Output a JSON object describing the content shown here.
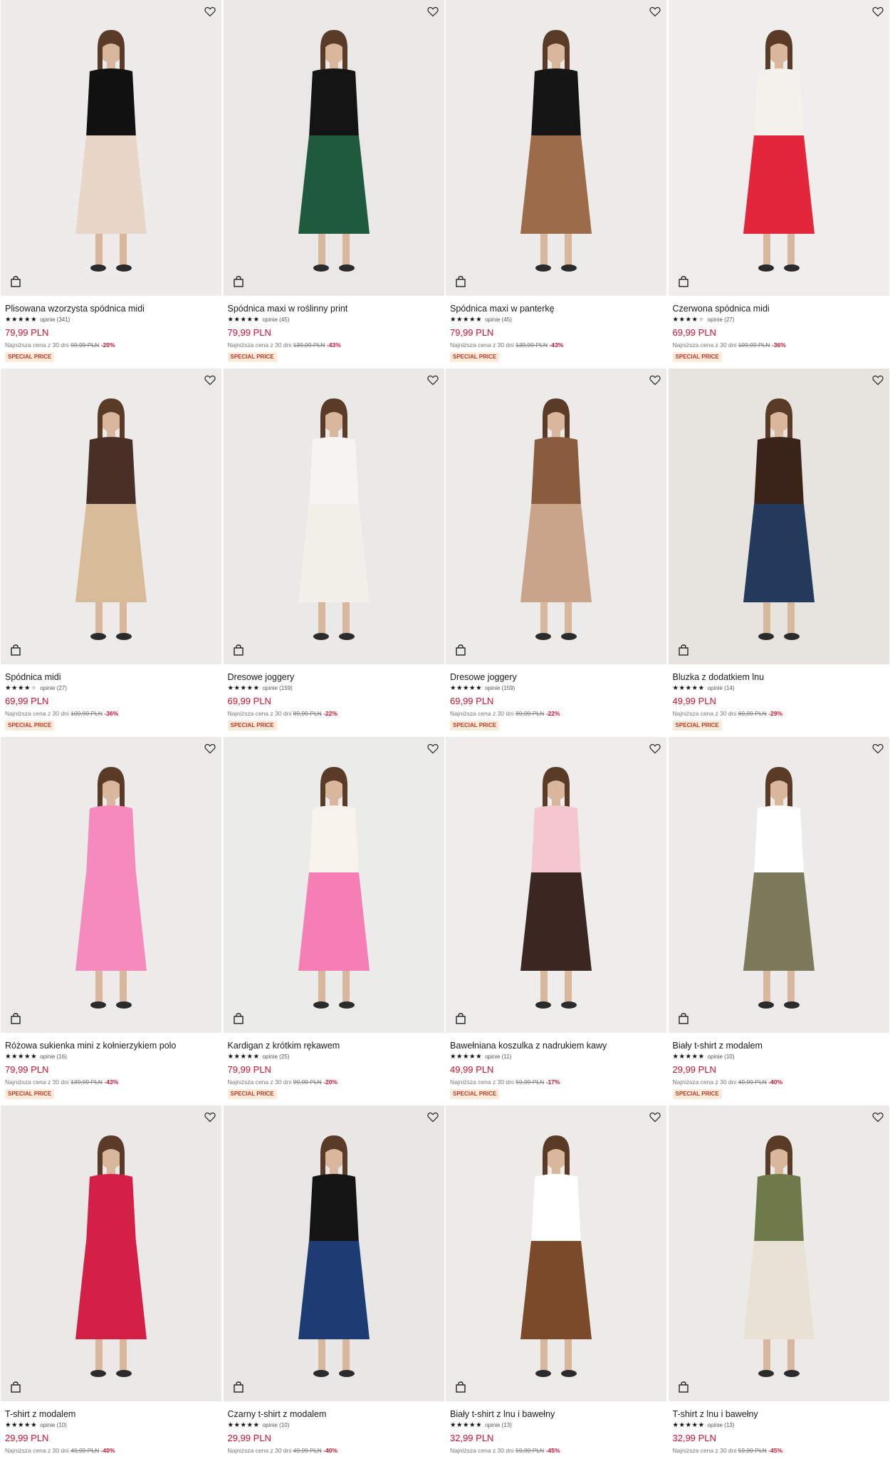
{
  "products": [
    {
      "name": "Plisowana wzorzysta spódnica midi",
      "stars": 5,
      "reviews": "opinie (341)",
      "price": "79,99 PLN",
      "lowest_label": "Najniższa cena z 30 dni",
      "old_price": "99,99 PLN",
      "discount": "-20%",
      "badge": "SPECIAL PRICE",
      "bg": "#eeeceb",
      "top": "#111111",
      "bottom": "#e8d6c7"
    },
    {
      "name": "Spódnica maxi w roślinny print",
      "stars": 5,
      "reviews": "opinie (45)",
      "price": "79,99 PLN",
      "lowest_label": "Najniższa cena z 30 dni",
      "old_price": "139,99 PLN",
      "discount": "-43%",
      "badge": "SPECIAL PRICE",
      "bg": "#e9e8e6",
      "top": "#141414",
      "bottom": "#1f5a3c"
    },
    {
      "name": "Spódnica maxi w panterkę",
      "stars": 5,
      "reviews": "opinie (45)",
      "price": "79,99 PLN",
      "lowest_label": "Najniższa cena z 30 dni",
      "old_price": "139,99 PLN",
      "discount": "-43%",
      "badge": "SPECIAL PRICE",
      "bg": "#ecebe9",
      "top": "#151515",
      "bottom": "#9b6b4a"
    },
    {
      "name": "Czerwona spódnica midi",
      "stars": 4,
      "reviews": "opinie (27)",
      "price": "69,99 PLN",
      "lowest_label": "Najniższa cena z 30 dni",
      "old_price": "109,99 PLN",
      "discount": "-36%",
      "badge": "SPECIAL PRICE",
      "bg": "#efeeec",
      "top": "#f4f1ec",
      "bottom": "#e3263b"
    },
    {
      "name": "Spódnica midi",
      "stars": 4,
      "reviews": "opinie (27)",
      "price": "69,99 PLN",
      "lowest_label": "Najniższa cena z 30 dni",
      "old_price": "109,99 PLN",
      "discount": "-36%",
      "badge": "SPECIAL PRICE",
      "bg": "#ecebea",
      "top": "#4a2f26",
      "bottom": "#d8bb98"
    },
    {
      "name": "Dresowe joggery",
      "stars": 5,
      "reviews": "opinie (159)",
      "price": "69,99 PLN",
      "lowest_label": "Najniższa cena z 30 dni",
      "old_price": "89,99 PLN",
      "discount": "-22%",
      "badge": "SPECIAL PRICE",
      "bg": "#ebe9e7",
      "top": "#f6f4f0",
      "bottom": "#f2efe9"
    },
    {
      "name": "Dresowe joggery",
      "stars": 5,
      "reviews": "opinie (159)",
      "price": "69,99 PLN",
      "lowest_label": "Najniższa cena z 30 dni",
      "old_price": "89,99 PLN",
      "discount": "-22%",
      "badge": "SPECIAL PRICE",
      "bg": "#ecebe9",
      "top": "#8a5c3e",
      "bottom": "#c9a48a"
    },
    {
      "name": "Bluzka z dodatkiem lnu",
      "stars": 5,
      "reviews": "opinie (14)",
      "price": "49,99 PLN",
      "lowest_label": "Najniższa cena z 30 dni",
      "old_price": "69,99 PLN",
      "discount": "-29%",
      "badge": "SPECIAL PRICE",
      "bg": "#e7e4df",
      "top": "#3a241a",
      "bottom": "#243a5c"
    },
    {
      "name": "Różowa sukienka mini z kołnierzykiem polo",
      "stars": 5,
      "reviews": "opinie (16)",
      "price": "79,99 PLN",
      "lowest_label": "Najniższa cena z 30 dni",
      "old_price": "139,99 PLN",
      "discount": "-43%",
      "badge": "SPECIAL PRICE",
      "bg": "#ecebe9",
      "top": "#f58bbd",
      "bottom": "#f58bbd"
    },
    {
      "name": "Kardigan z krótkim rękawem",
      "stars": 5,
      "reviews": "opinie (25)",
      "price": "79,99 PLN",
      "lowest_label": "Najniższa cena z 30 dni",
      "old_price": "99,99 PLN",
      "discount": "-20%",
      "badge": "SPECIAL PRICE",
      "bg": "#ebebea",
      "top": "#f7f3ea",
      "bottom": "#f57fb4"
    },
    {
      "name": "Bawełniana koszulka z nadrukiem kawy",
      "stars": 4.5,
      "reviews": "opinie (11)",
      "price": "49,99 PLN",
      "lowest_label": "Najniższa cena z 30 dni",
      "old_price": "59,99 PLN",
      "discount": "-17%",
      "badge": "SPECIAL PRICE",
      "bg": "#eeedeb",
      "top": "#f4c6cf",
      "bottom": "#3b2722"
    },
    {
      "name": "Biały t-shirt z modalem",
      "stars": 4.5,
      "reviews": "opinie (10)",
      "price": "29,99 PLN",
      "lowest_label": "Najniższa cena z 30 dni",
      "old_price": "49,99 PLN",
      "discount": "-40%",
      "badge": "SPECIAL PRICE",
      "bg": "#ecebe9",
      "top": "#ffffff",
      "bottom": "#7d7a5c"
    },
    {
      "name": "T-shirt z modalem",
      "stars": 4.5,
      "reviews": "opinie (10)",
      "price": "29,99 PLN",
      "lowest_label": "Najniższa cena z 30 dni",
      "old_price": "49,99 PLN",
      "discount": "-40%",
      "badge": "",
      "bg": "#eae9e7",
      "top": "#d41f46",
      "bottom": "#d41f46"
    },
    {
      "name": "Czarny t-shirt z modalem",
      "stars": 4.5,
      "reviews": "opinie (10)",
      "price": "29,99 PLN",
      "lowest_label": "Najniższa cena z 30 dni",
      "old_price": "49,99 PLN",
      "discount": "-40%",
      "badge": "",
      "bg": "#e8e7e5",
      "top": "#141414",
      "bottom": "#1d3c73"
    },
    {
      "name": "Biały t-shirt z lnu i bawełny",
      "stars": 4.5,
      "reviews": "opinie (13)",
      "price": "32,99 PLN",
      "lowest_label": "Najniższa cena z 30 dni",
      "old_price": "59,99 PLN",
      "discount": "-45%",
      "badge": "",
      "bg": "#ecebe8",
      "top": "#ffffff",
      "bottom": "#7a4a2b"
    },
    {
      "name": "T-shirt z lnu i bawełny",
      "stars": 4.5,
      "reviews": "opinie (13)",
      "price": "32,99 PLN",
      "lowest_label": "Najniższa cena z 30 dni",
      "old_price": "59,99 PLN",
      "discount": "-45%",
      "badge": "",
      "bg": "#eceae7",
      "top": "#6f7a4a",
      "bottom": "#e9e1d3"
    }
  ],
  "icons": {
    "favorite": "heart-icon",
    "add_to_bag": "bag-icon",
    "star": "star-icon"
  },
  "colors": {
    "price": "#d0102e",
    "badge_bg": "#fdebd9",
    "badge_text": "#c0392b"
  }
}
